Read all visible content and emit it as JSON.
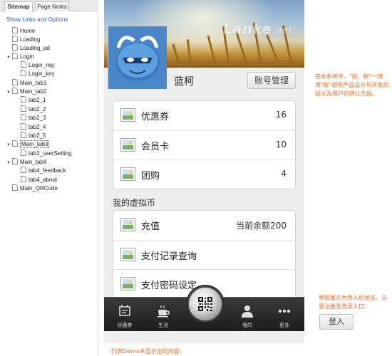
{
  "sitemap": {
    "tabs": [
      "Sitemap",
      "Page Notes"
    ],
    "show_links": "Show Links and Options",
    "nodes": [
      {
        "label": "Home",
        "toggle": ""
      },
      {
        "label": "Loading",
        "toggle": ""
      },
      {
        "label": "Loading_ad",
        "toggle": ""
      },
      {
        "label": "Login",
        "toggle": "▼"
      },
      {
        "label": "Login_reg",
        "toggle": ""
      },
      {
        "label": "Login_key",
        "toggle": ""
      },
      {
        "label": "Main_tab1",
        "toggle": ""
      },
      {
        "label": "Main_tab2",
        "toggle": "▼"
      },
      {
        "label": "tab2_1",
        "toggle": ""
      },
      {
        "label": "tab2_2",
        "toggle": ""
      },
      {
        "label": "tab2_3",
        "toggle": ""
      },
      {
        "label": "tab2_4",
        "toggle": ""
      },
      {
        "label": "tab2_5",
        "toggle": ""
      },
      {
        "label": "Main_tab3",
        "toggle": "▼",
        "selected": true
      },
      {
        "label": "tab3_userSetting",
        "toggle": ""
      },
      {
        "label": "Main_tab4",
        "toggle": "▼"
      },
      {
        "label": "tab4_feedback",
        "toggle": ""
      },
      {
        "label": "tab4_about",
        "toggle": ""
      },
      {
        "label": "Main_QRCode",
        "toggle": ""
      }
    ]
  },
  "profile": {
    "watermark": "Lanke",
    "watermark_suffix": ".net",
    "username": "蓝柯",
    "account_button": "账号管理"
  },
  "cards": {
    "top": [
      {
        "label": "优惠券",
        "count": "16"
      },
      {
        "label": "会员卡",
        "count": "10"
      },
      {
        "label": "团购",
        "count": "4"
      }
    ],
    "section_title": "我的虚拟币",
    "bottom": [
      {
        "label": "充值",
        "count": "当前余额200"
      },
      {
        "label": "支付记录查询",
        "count": ""
      },
      {
        "label": "支付密码设定",
        "count": ""
      }
    ]
  },
  "tabbar": {
    "tabs": [
      "优惠券",
      "生活",
      "我的",
      "更多"
    ]
  },
  "annotations": {
    "note1": "在本系统中，\"账、帐\"一律用\"账\"避免产品设计与开发的疑义及用户的辨认负担。",
    "note2": "界面展示为登入后状态，示意注册及登录入口：",
    "login_button": "登入",
    "note3": "列表Demo未显示全的内容："
  },
  "colors": {
    "annotation": "#ec6a23",
    "link": "#2a62c9",
    "tabbar": "#262626"
  }
}
